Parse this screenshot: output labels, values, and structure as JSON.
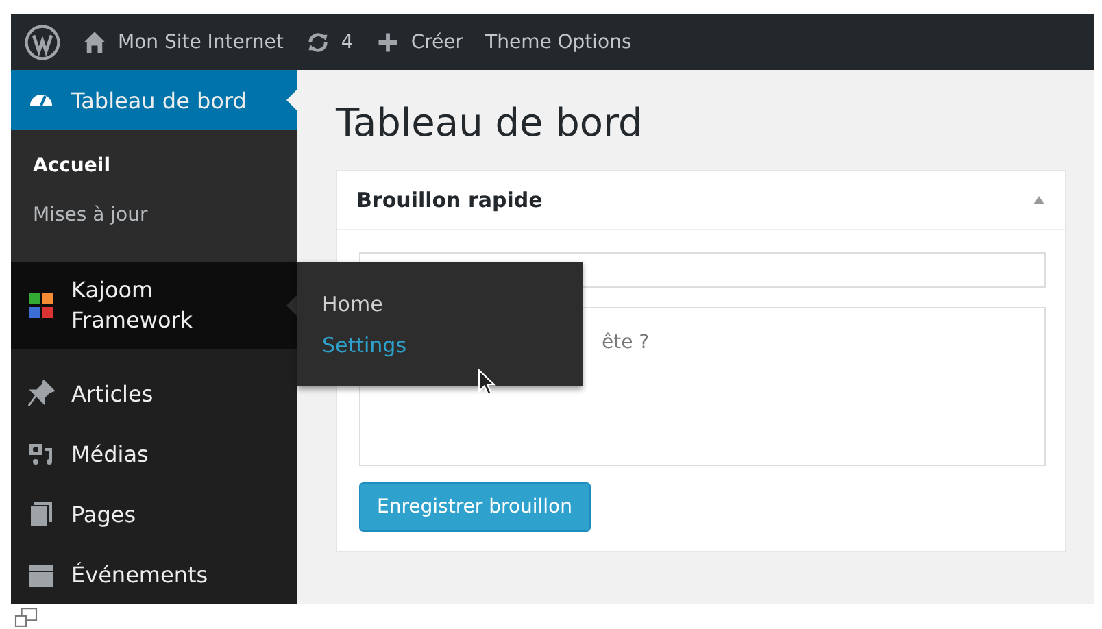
{
  "admin_bar": [
    {
      "kind": "wordpress"
    },
    {
      "kind": "home",
      "label": "Mon Site Internet"
    },
    {
      "kind": "updates",
      "label": "4"
    },
    {
      "kind": "new",
      "label": "Créer"
    },
    {
      "kind": "text",
      "label": "Theme Options"
    }
  ],
  "sidebar": {
    "items": [
      {
        "label": "Tableau de bord",
        "selected": true,
        "submenu": [
          {
            "label": "Accueil",
            "selected": true
          },
          {
            "label": "Mises à jour",
            "selected": false
          }
        ]
      },
      {
        "label": "Kajoom Framework",
        "selected": false,
        "hovered": true,
        "flyout": [
          {
            "label": "Home",
            "selected": false
          },
          {
            "label": "Settings",
            "selected": true
          }
        ]
      },
      {
        "label": "Articles",
        "selected": false
      },
      {
        "label": "Médias",
        "selected": false
      },
      {
        "label": "Pages",
        "selected": false
      },
      {
        "label": "Événements",
        "selected": false
      }
    ]
  },
  "page_title": "Tableau de bord",
  "card": {
    "title": "Brouillon rapide",
    "expanded": true,
    "content_placeholder": "ête ?",
    "button": "Enregistrer brouillon"
  }
}
